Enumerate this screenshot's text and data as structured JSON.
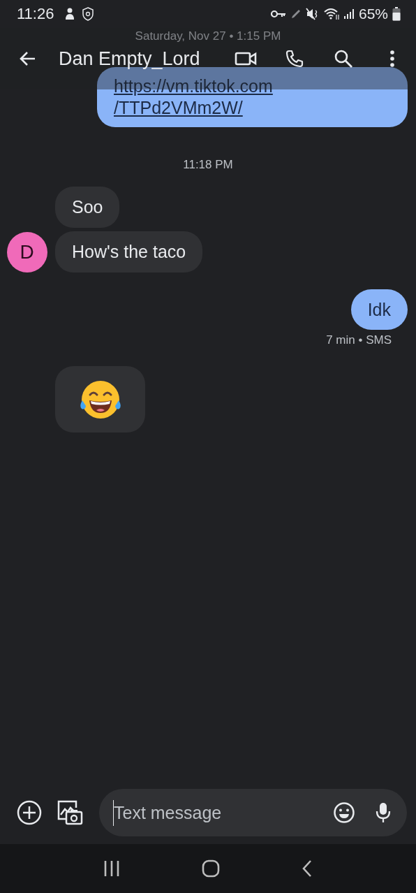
{
  "status_bar": {
    "time": "11:26",
    "battery": "65%"
  },
  "header": {
    "title": "Dan Empty_Lord"
  },
  "messages": [
    {
      "kind": "date",
      "text": "Saturday, Nov 27 • 1:15 PM"
    },
    {
      "kind": "link",
      "lines": [
        "https://vm.tiktok.com",
        "/TTPd2VMm2W/"
      ]
    },
    {
      "kind": "time",
      "text": "11:18 PM"
    },
    {
      "kind": "incoming",
      "text": "Soo"
    },
    {
      "kind": "incoming",
      "text": "How's the taco",
      "avatar": "D"
    },
    {
      "kind": "outgoing",
      "text": "Idk",
      "meta": "7 min • SMS"
    },
    {
      "kind": "sticker"
    }
  ],
  "composer": {
    "placeholder": "Text message"
  }
}
